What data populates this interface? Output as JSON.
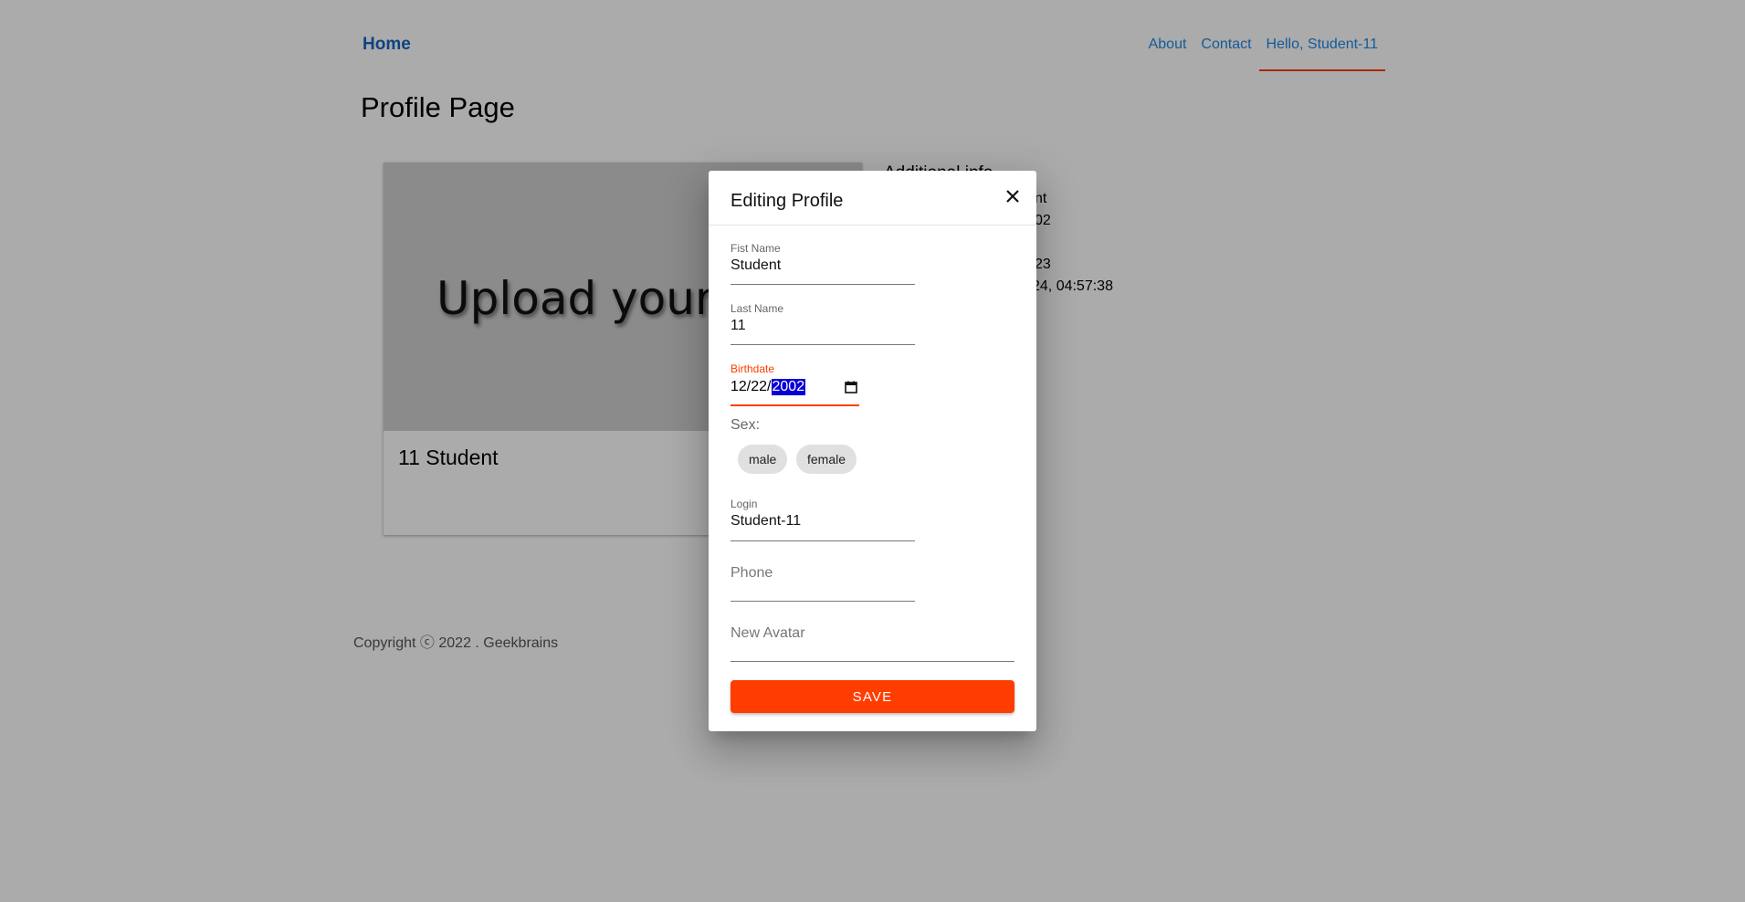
{
  "nav": {
    "home": "Home",
    "links": [
      "About",
      "Contact",
      "Hello, Student-11"
    ]
  },
  "page_title": "Profile Page",
  "card": {
    "image_text": "Upload your a",
    "name": "11 Student"
  },
  "info": {
    "title": "Additional info",
    "lines": [
      "nt",
      "02",
      "23",
      "24, 04:57:38"
    ]
  },
  "footer": "Copyright ⓒ 2022 . Geekbrains",
  "dialog": {
    "title": "Editing Profile",
    "first_name": {
      "label": "Fist Name",
      "value": "Student"
    },
    "last_name": {
      "label": "Last Name",
      "value": "11"
    },
    "birthdate": {
      "label": "Birthdate",
      "month": "12",
      "day": "22",
      "year": "2002",
      "sep": "/"
    },
    "sex_label": "Sex:",
    "sex_options": [
      "male",
      "female"
    ],
    "login": {
      "label": "Login",
      "value": "Student-11"
    },
    "phone": {
      "placeholder": "Phone"
    },
    "avatar": {
      "placeholder": "New Avatar"
    },
    "save_label": "SAVE"
  },
  "colors": {
    "accent": "#ff3d00",
    "link": "#1e88e5",
    "home_link": "#1565c0"
  },
  "icons": {
    "close": "close-icon",
    "calendar": "calendar-icon"
  }
}
